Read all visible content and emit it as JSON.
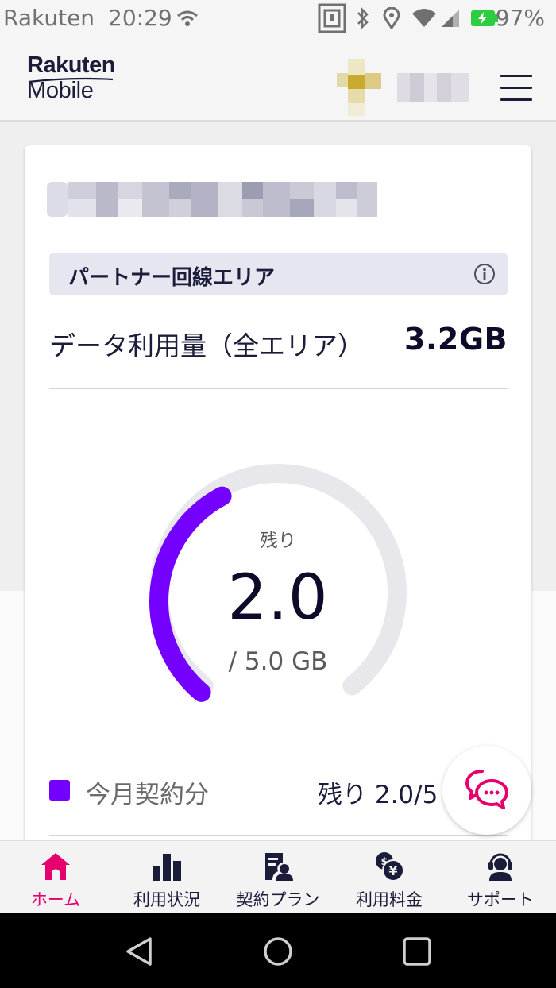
{
  "status_bar": {
    "carrier": "Rakuten",
    "time": "20:29",
    "battery_percent": "97%"
  },
  "header": {
    "logo_line1": "Rakuten",
    "logo_line2": "Mobile"
  },
  "card": {
    "area_banner_label": "パートナー回線エリア",
    "usage_label": "データ利用量（全エリア）",
    "usage_value": "3.2GB",
    "gauge": {
      "caption": "残り",
      "remaining": "2.0",
      "total_text": "/ 5.0 GB",
      "remaining_fraction": 0.4
    },
    "legend": {
      "label": "今月契約分",
      "value": "残り 2.0/5"
    }
  },
  "bottom_nav": [
    {
      "label": "ホーム",
      "icon": "home-icon",
      "active": true
    },
    {
      "label": "利用状況",
      "icon": "bar-chart-icon",
      "active": false
    },
    {
      "label": "契約プラン",
      "icon": "contract-icon",
      "active": false
    },
    {
      "label": "利用料金",
      "icon": "yen-coin-icon",
      "active": false
    },
    {
      "label": "サポート",
      "icon": "support-agent-icon",
      "active": false
    }
  ],
  "colors": {
    "accent_purple": "#7400ff",
    "brand_magenta": "#e6006e",
    "navy_text": "#1b1c3a",
    "gauge_track": "#e8e8ec"
  }
}
